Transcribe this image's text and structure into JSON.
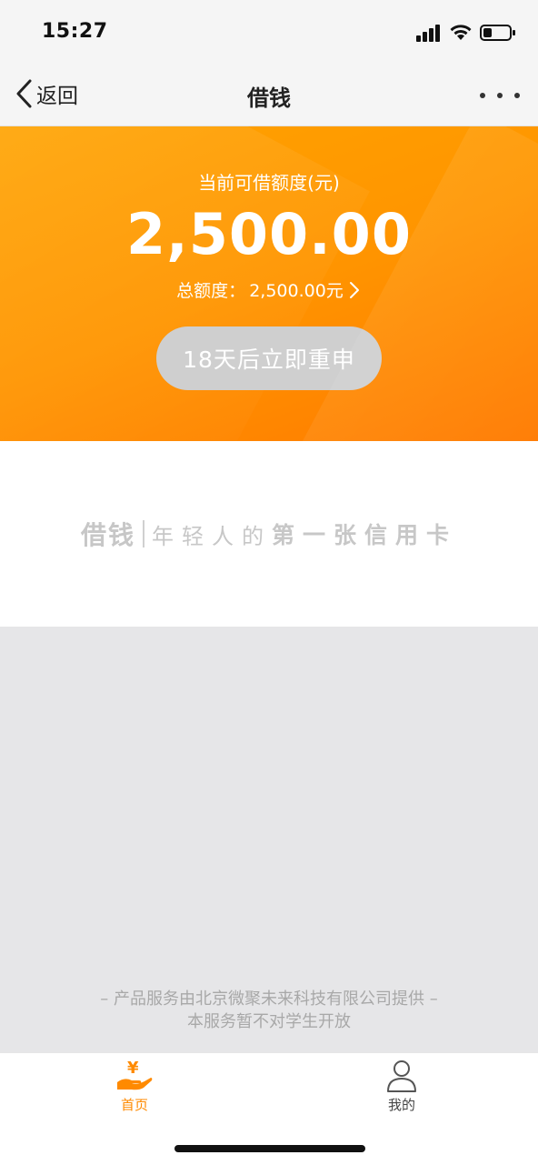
{
  "status_bar": {
    "time": "15:27"
  },
  "nav": {
    "back_label": "返回",
    "title": "借钱"
  },
  "hero": {
    "label": "当前可借额度(元)",
    "amount": "2,500.00",
    "total_label": "总额度：",
    "total_value": "2,500.00元",
    "button_label": "18天后立即重申"
  },
  "slogan": {
    "brand": "借钱",
    "text": "年轻人的",
    "strong": "第一张信用卡"
  },
  "footer": {
    "line1": "– 产品服务由北京微聚未来科技有限公司提供 –",
    "line2": "本服务暂不对学生开放"
  },
  "tabs": [
    {
      "label": "首页",
      "icon": "yen-hand-icon",
      "active": true
    },
    {
      "label": "我的",
      "icon": "user-icon",
      "active": false
    }
  ],
  "colors": {
    "accent": "#ff8a00",
    "hero_start": "#ffa300",
    "hero_end": "#ff7a00",
    "disabled_button": "#cfcfcf"
  }
}
